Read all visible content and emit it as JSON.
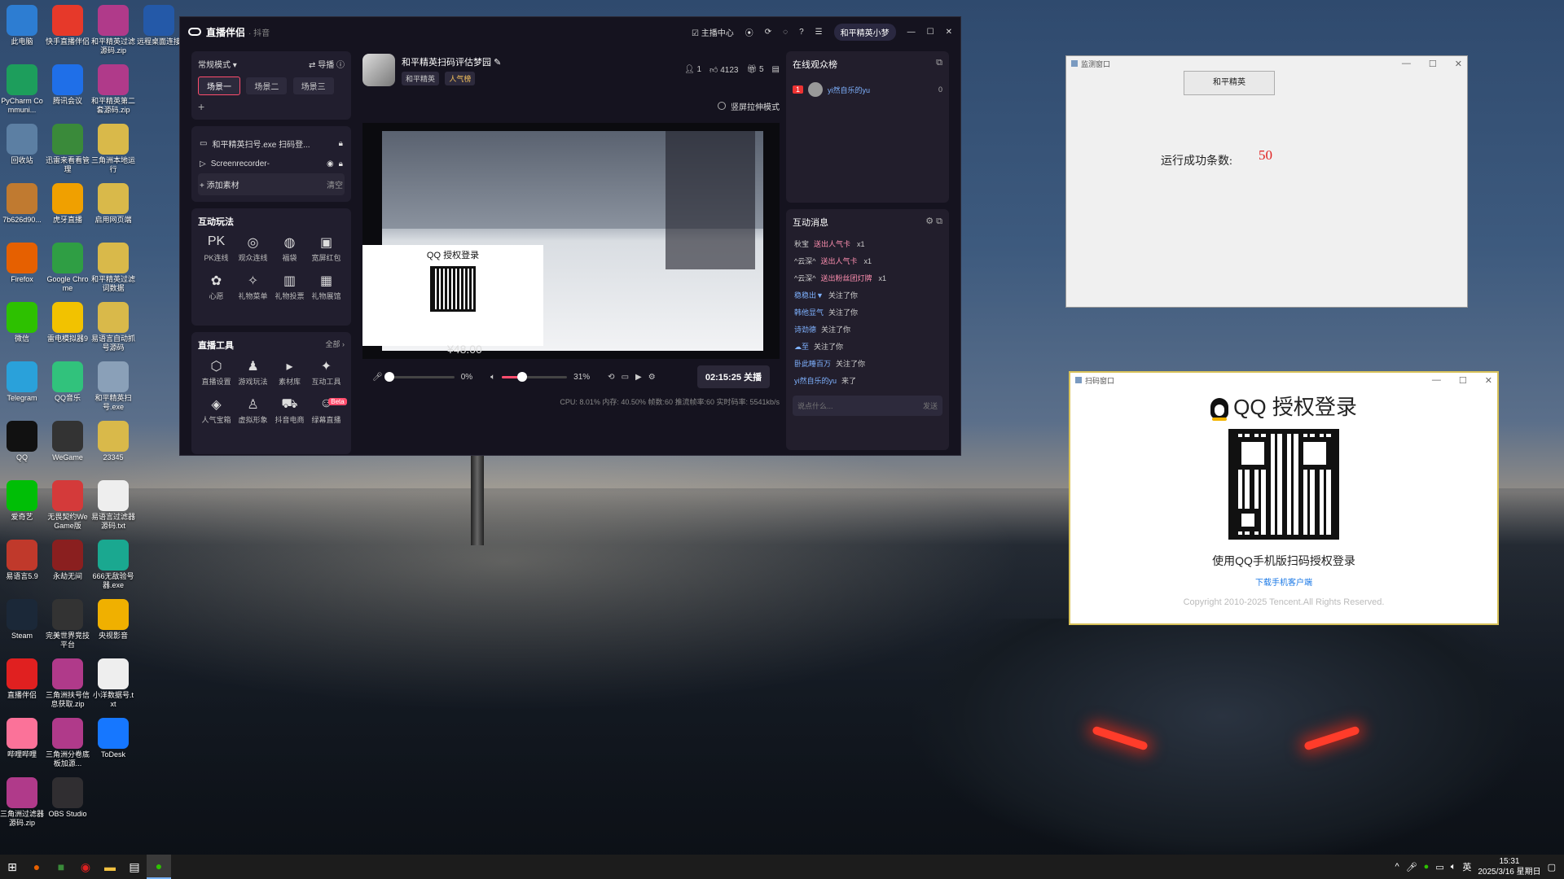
{
  "desktop": {
    "icons": [
      {
        "label": "此电脑",
        "icon": "computer-icon",
        "color": "#2d7dd2"
      },
      {
        "label": "快手直播伴侣",
        "icon": "kuaishou-icon",
        "color": "#e6392a"
      },
      {
        "label": "和平精英过滤源码.zip",
        "icon": "archive-icon",
        "color": "#b03a8a"
      },
      {
        "label": "远程桌面连接",
        "icon": "remote-desktop-icon",
        "color": "#2459a8"
      },
      {
        "label": "PyCharm Communi...",
        "icon": "pycharm-icon",
        "color": "#1d9e5c"
      },
      {
        "label": "腾讯会议",
        "icon": "tencent-meeting-icon",
        "color": "#1f6fe8"
      },
      {
        "label": "和平精英第二套源码.zip",
        "icon": "archive-icon",
        "color": "#b03a8a"
      },
      {
        "label": "回收站",
        "icon": "recycle-bin-icon",
        "color": "#5c7fa3"
      },
      {
        "label": "迅雷来看看管理",
        "icon": "manager-icon",
        "color": "#3a8a3a"
      },
      {
        "label": "三角洲本地运行",
        "icon": "folder-icon",
        "color": "#d9b94a"
      },
      {
        "label": "7b626d90...",
        "icon": "app-icon",
        "color": "#c07a30"
      },
      {
        "label": "虎牙直播",
        "icon": "huya-icon",
        "color": "#f0a000"
      },
      {
        "label": "启用网页端",
        "icon": "folder-icon",
        "color": "#d9b94a"
      },
      {
        "label": "Firefox",
        "icon": "firefox-icon",
        "color": "#e66000"
      },
      {
        "label": "Google Chrome",
        "icon": "chrome-icon",
        "color": "#2f9e44"
      },
      {
        "label": "和平精英过滤词数据",
        "icon": "folder-icon",
        "color": "#d9b94a"
      },
      {
        "label": "微信",
        "icon": "wechat-icon",
        "color": "#2dc100"
      },
      {
        "label": "雷电模拟器9",
        "icon": "ldplayer-icon",
        "color": "#f2c200"
      },
      {
        "label": "易语言自动抓号源码",
        "icon": "folder-icon",
        "color": "#d9b94a"
      },
      {
        "label": "Telegram",
        "icon": "telegram-icon",
        "color": "#2aa1da"
      },
      {
        "label": "QQ音乐",
        "icon": "qqmusic-icon",
        "color": "#31c27c"
      },
      {
        "label": "和平精英扫号.exe",
        "icon": "exe-icon",
        "color": "#8aa0b8"
      },
      {
        "label": "QQ",
        "icon": "qq-icon",
        "color": "#111111"
      },
      {
        "label": "WeGame",
        "icon": "wegame-icon",
        "color": "#333333"
      },
      {
        "label": "23345",
        "icon": "folder-icon",
        "color": "#d9b94a"
      },
      {
        "label": "爱奇艺",
        "icon": "iqiyi-icon",
        "color": "#00be06"
      },
      {
        "label": "无畏契约WeGame版",
        "icon": "valorant-icon",
        "color": "#d43a3a"
      },
      {
        "label": "易语言过滤器源码.txt",
        "icon": "text-file-icon",
        "color": "#eeeeee"
      },
      {
        "label": "易语言5.9",
        "icon": "eyuyan-icon",
        "color": "#c0392b"
      },
      {
        "label": "永劫无间",
        "icon": "naraka-icon",
        "color": "#8a1f1f"
      },
      {
        "label": "666无敌验号器.exe",
        "icon": "exe-icon",
        "color": "#1aa890"
      },
      {
        "label": "Steam",
        "icon": "steam-icon",
        "color": "#1b2838"
      },
      {
        "label": "完美世界竞技平台",
        "icon": "perfect-world-icon",
        "color": "#333333"
      },
      {
        "label": "央视影音",
        "icon": "cctv-icon",
        "color": "#f0b000"
      },
      {
        "label": "直播伴侣",
        "icon": "live-companion-icon",
        "color": "#e02020"
      },
      {
        "label": "三角洲扶号信息获取.zip",
        "icon": "archive-icon",
        "color": "#b03a8a"
      },
      {
        "label": "小洋数据号.txt",
        "icon": "text-file-icon",
        "color": "#eeeeee"
      },
      {
        "label": "哔哩哔哩",
        "icon": "bilibili-icon",
        "color": "#fb7299"
      },
      {
        "label": "三角洲分卷底板加源...",
        "icon": "archive-icon",
        "color": "#b03a8a"
      },
      {
        "label": "ToDesk",
        "icon": "todesk-icon",
        "color": "#1677ff"
      },
      {
        "label": "三角洲过滤器源码.zip",
        "icon": "archive-icon",
        "color": "#b03a8a"
      },
      {
        "label": "OBS Studio",
        "icon": "obs-icon",
        "color": "#302e31"
      }
    ]
  },
  "app": {
    "brand": "直播伴侣",
    "platform": "· 抖音",
    "header": {
      "center": "主播中心",
      "user": "和平精英小梦"
    },
    "mode": "常规模式",
    "guide": "导播",
    "scenes": [
      "场景一",
      "场景二",
      "场景三"
    ],
    "add": "+",
    "sources": [
      {
        "label": "和平精英扫号.exe 扫码登..."
      },
      {
        "label": "Screenrecorder-"
      }
    ],
    "add_material": "添加素材",
    "clear": "清空",
    "interactive_title": "互动玩法",
    "interactive": [
      "PK连线",
      "观众连线",
      "福袋",
      "宽屏红包",
      "心愿",
      "礼物菜单",
      "礼物投票",
      "礼物展馆"
    ],
    "tools_title": "直播工具",
    "tools_all": "全部 ›",
    "tools": [
      "直播设置",
      "游戏玩法",
      "素材库",
      "互动工具",
      "人气宝箱",
      "虚拟形象",
      "抖音电商",
      "绿幕直播"
    ],
    "beta": "Beta",
    "stream": {
      "title": "和平精英扫码评估梦园",
      "tag1": "和平精英",
      "tag2": "人气榜",
      "viewers": "1",
      "likes": "4123",
      "gifts": "5",
      "portrait_mode": "竖屏拉伸模式"
    },
    "preview_qr_title": "QQ 授权登录",
    "preview_number": "¥48.00",
    "mic_pct": "0%",
    "vol_pct": "31%",
    "mic_value": 0,
    "vol_value": 31,
    "live_time": "02:15:25 关播",
    "status": "CPU: 8.01%  内存: 40.50%  帧数:60  推流帧率:60  实时码率: 5541kb/s",
    "online_title": "在线观众榜",
    "online_user": "yi然自乐的yu",
    "online_rank": "1",
    "online_score": "0",
    "msg_title": "互动消息",
    "messages": [
      {
        "user": "秋宝",
        "text": "送出人气卡",
        "count": "x1"
      },
      {
        "user": "^云深^",
        "text": "送出人气卡",
        "count": "x1"
      },
      {
        "user": "^云深^",
        "text": "送出粉丝团灯牌",
        "count": "x1"
      },
      {
        "user": "稳稳出▼",
        "text": "关注了你"
      },
      {
        "user": "韩他显气",
        "text": "关注了你"
      },
      {
        "user": "诗劲德",
        "text": "关注了你"
      },
      {
        "user": "☁至",
        "text": "关注了你"
      },
      {
        "user": "卧此睡百万",
        "text": "关注了你"
      },
      {
        "user": "yi然自乐的yu",
        "text": "来了"
      }
    ],
    "chat_placeholder": "说点什么...",
    "send": "发送"
  },
  "monitor": {
    "title": "监测窗口",
    "button": "和平精英",
    "label": "运行成功条数:",
    "value": "50",
    "value_color": "#e02020"
  },
  "qr_window": {
    "title": "扫码窗口",
    "heading": "QQ 授权登录",
    "hint": "使用QQ手机版扫码授权登录",
    "link": "下载手机客户端",
    "copyright": "Copyright 2010-2025 Tencent.All Rights Reserved."
  },
  "taskbar": {
    "time": "15:31",
    "date": "2025/3/16 星期日",
    "ime": "英"
  }
}
